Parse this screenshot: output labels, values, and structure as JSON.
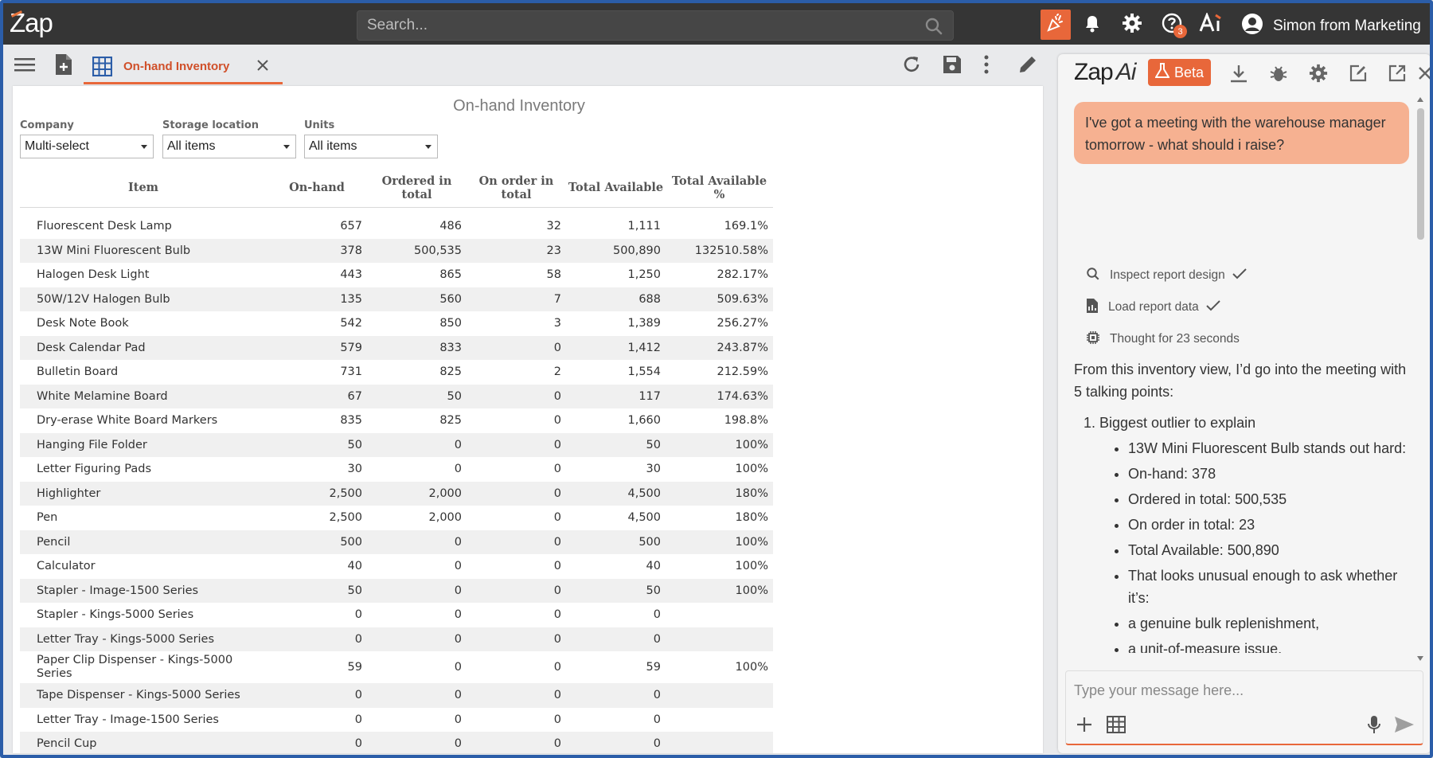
{
  "app": {
    "logo": "Zap",
    "search_placeholder": "Search...",
    "help_badge": "3",
    "user_name": "Simon from Marketing"
  },
  "tab": {
    "label": "On-hand Inventory"
  },
  "report": {
    "title": "On-hand Inventory",
    "filters": [
      {
        "label": "Company",
        "value": "Multi-select"
      },
      {
        "label": "Storage location",
        "value": "All items"
      },
      {
        "label": "Units",
        "value": "All items"
      }
    ],
    "columns": [
      "Item",
      "On-hand",
      "Ordered in total",
      "On order in total",
      "Total Available",
      "Total Available %"
    ],
    "rows": [
      [
        "Fluorescent Desk Lamp",
        "657",
        "486",
        "32",
        "1,111",
        "169.1%"
      ],
      [
        "13W Mini Fluorescent Bulb",
        "378",
        "500,535",
        "23",
        "500,890",
        "132510.58%"
      ],
      [
        "Halogen Desk Light",
        "443",
        "865",
        "58",
        "1,250",
        "282.17%"
      ],
      [
        "50W/12V Halogen Bulb",
        "135",
        "560",
        "7",
        "688",
        "509.63%"
      ],
      [
        "Desk Note Book",
        "542",
        "850",
        "3",
        "1,389",
        "256.27%"
      ],
      [
        "Desk Calendar Pad",
        "579",
        "833",
        "0",
        "1,412",
        "243.87%"
      ],
      [
        "Bulletin Board",
        "731",
        "825",
        "2",
        "1,554",
        "212.59%"
      ],
      [
        "White Melamine Board",
        "67",
        "50",
        "0",
        "117",
        "174.63%"
      ],
      [
        "Dry-erase White Board Markers",
        "835",
        "825",
        "0",
        "1,660",
        "198.8%"
      ],
      [
        "Hanging File Folder",
        "50",
        "0",
        "0",
        "50",
        "100%"
      ],
      [
        "Letter Figuring Pads",
        "30",
        "0",
        "0",
        "30",
        "100%"
      ],
      [
        "Highlighter",
        "2,500",
        "2,000",
        "0",
        "4,500",
        "180%"
      ],
      [
        "Pen",
        "2,500",
        "2,000",
        "0",
        "4,500",
        "180%"
      ],
      [
        "Pencil",
        "500",
        "0",
        "0",
        "500",
        "100%"
      ],
      [
        "Calculator",
        "40",
        "0",
        "0",
        "40",
        "100%"
      ],
      [
        "Stapler - Image-1500 Series",
        "50",
        "0",
        "0",
        "50",
        "100%"
      ],
      [
        "Stapler - Kings-5000 Series",
        "0",
        "0",
        "0",
        "0",
        ""
      ],
      [
        "Letter Tray - Kings-5000 Series",
        "0",
        "0",
        "0",
        "0",
        ""
      ],
      [
        "Paper Clip Dispenser - Kings-5000 Series",
        "59",
        "0",
        "0",
        "59",
        "100%"
      ],
      [
        "Tape Dispenser - Kings-5000 Series",
        "0",
        "0",
        "0",
        "0",
        ""
      ],
      [
        "Letter Tray - Image-1500 Series",
        "0",
        "0",
        "0",
        "0",
        ""
      ],
      [
        "Pencil Cup",
        "0",
        "0",
        "0",
        "0",
        ""
      ]
    ]
  },
  "ai": {
    "logo": "Zap",
    "logo_ai": "Ai",
    "beta_label": "Beta",
    "user_message": "I've got a meeting with the warehouse manager tomorrow - what should i raise?",
    "steps": [
      {
        "icon": "search-icon",
        "text": "Inspect report design",
        "done": true
      },
      {
        "icon": "document-icon",
        "text": "Load report data",
        "done": true
      },
      {
        "icon": "chip-icon",
        "text": "Thought for 23 seconds",
        "done": false
      }
    ],
    "response_intro": "From this inventory view, I’d go into the meeting with 5 talking points:",
    "point1_title": "Biggest outlier to explain",
    "point1_bullets": [
      "13W Mini Fluorescent Bulb stands out hard:",
      "On-hand: 378",
      "Ordered in total: 500,535",
      "On order in total: 23",
      "Total Available: 500,890",
      "That looks unusual enough to ask whether it’s:",
      "a genuine bulk replenishment,",
      "a unit-of-measure issue,"
    ],
    "input_placeholder": "Type your message here..."
  },
  "colors": {
    "accent": "#e8673a",
    "header_bg": "#353535",
    "bubble": "#f6b191"
  }
}
